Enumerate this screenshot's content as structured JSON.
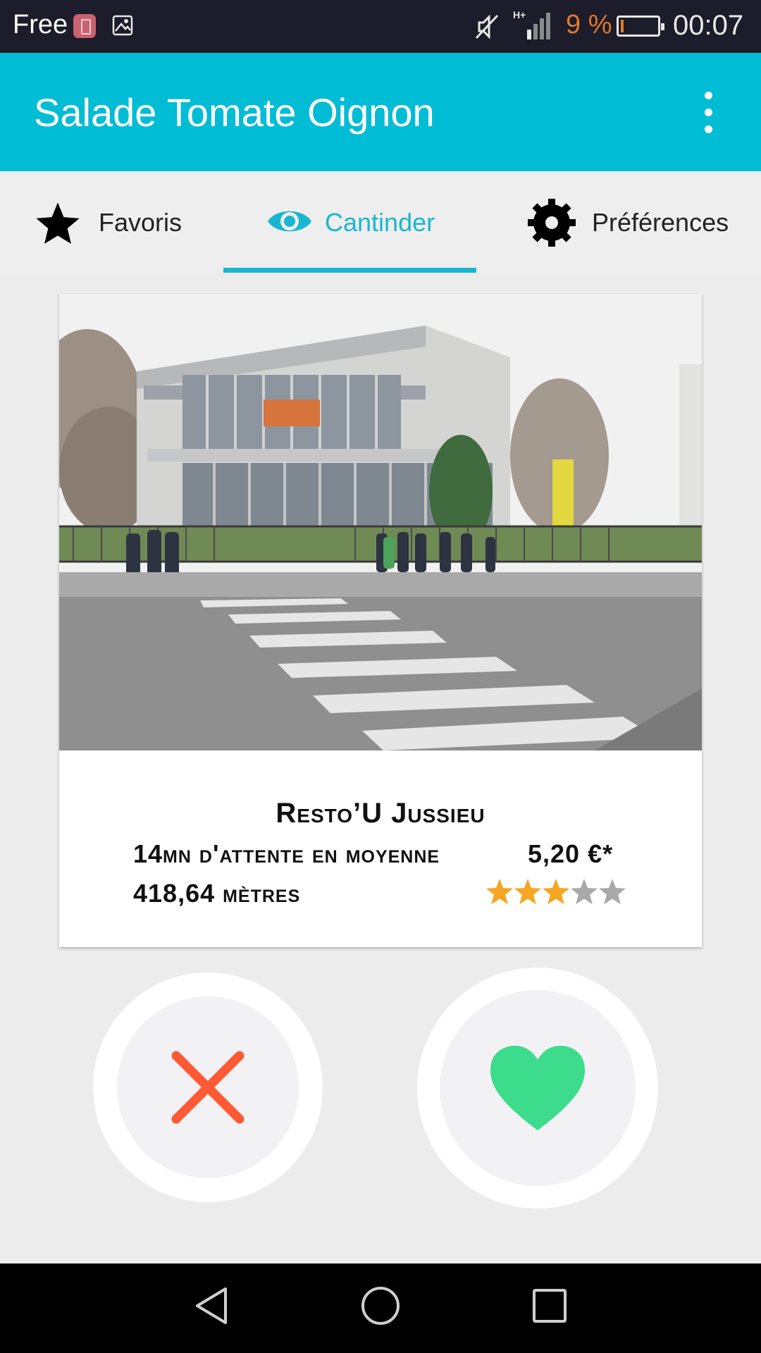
{
  "status_bar": {
    "carrier": "Free",
    "battery_percent": "9 %",
    "time": "00:07",
    "network": "H+"
  },
  "app_bar": {
    "title": "Salade Tomate Oignon",
    "menu_icon": "more-vert-icon"
  },
  "tabs": [
    {
      "label": "Favoris",
      "icon": "star-icon",
      "active": false
    },
    {
      "label": "Cantinder",
      "icon": "eye-icon",
      "active": true
    },
    {
      "label": "Préférences",
      "icon": "gear-icon",
      "active": false
    }
  ],
  "card": {
    "name": "Resto’U Jussieu",
    "wait": "14mn d'attente en moyenne",
    "price": "5,20 €*",
    "distance": "418,64 mètres",
    "rating": 3,
    "rating_max": 5
  },
  "actions": {
    "reject_icon": "close-icon",
    "like_icon": "heart-icon"
  },
  "colors": {
    "accent": "#00bcd4",
    "reject": "#ff5a36",
    "like": "#3ddc8c",
    "star_on": "#f5a623",
    "star_off": "#a9a9a9"
  }
}
